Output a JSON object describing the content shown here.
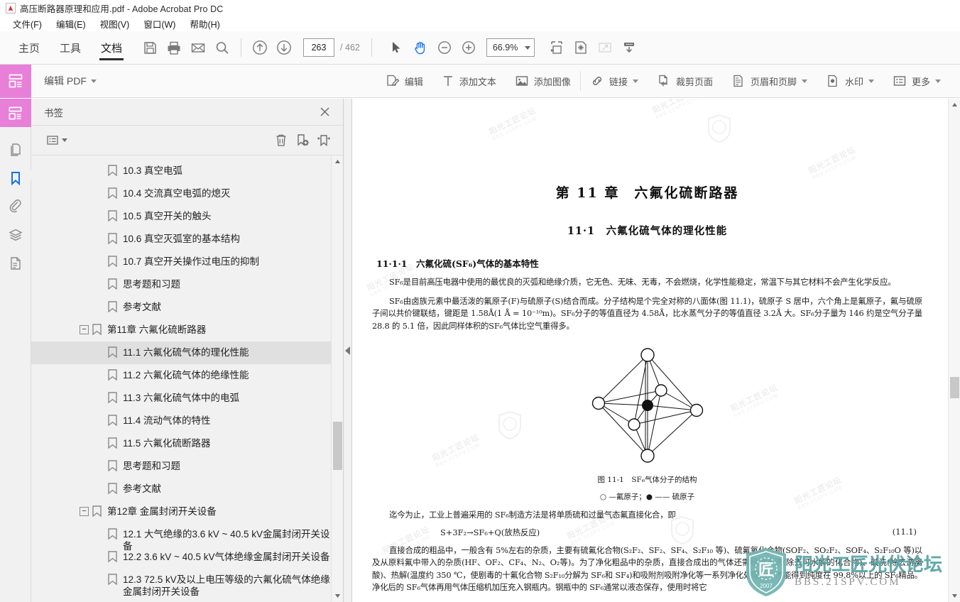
{
  "window": {
    "title": "高压断路器原理和应用.pdf - Adobe Acrobat Pro DC",
    "app_icon": "acrobat-logo-icon"
  },
  "menubar": {
    "items": [
      {
        "label": "文件(F)",
        "name": "menu-file"
      },
      {
        "label": "编辑(E)",
        "name": "menu-edit"
      },
      {
        "label": "视图(V)",
        "name": "menu-view"
      },
      {
        "label": "窗口(W)",
        "name": "menu-window"
      },
      {
        "label": "帮助(H)",
        "name": "menu-help"
      }
    ]
  },
  "toolbar": {
    "tabs": [
      {
        "label": "主页",
        "active": false
      },
      {
        "label": "工具",
        "active": false
      },
      {
        "label": "文档",
        "active": true
      }
    ],
    "buttons": [
      {
        "name": "save-button",
        "icon": "floppy-disk-icon"
      },
      {
        "name": "print-button",
        "icon": "printer-icon"
      },
      {
        "name": "email-button",
        "icon": "envelope-icon"
      },
      {
        "name": "search-button",
        "icon": "search-icon"
      }
    ],
    "prev_page_icon": "arrow-up-circle-icon",
    "next_page_icon": "arrow-down-circle-icon",
    "page_number": "263",
    "page_total": "/ 462",
    "select_tool_icon": "cursor-arrow-icon",
    "hand_tool_icon": "hand-icon",
    "zoom_out_icon": "minus-circle-icon",
    "zoom_in_icon": "plus-circle-icon",
    "zoom_value": "66.9%",
    "fit_width_icon": "fit-width-icon",
    "fit_page_icon": "fit-page-icon",
    "full_screen_icon": "full-screen-icon",
    "scroll_mode_icon": "scroll-mode-icon"
  },
  "subtoolbar": {
    "panel_icon": "edit-pdf-panel-icon",
    "title": "编辑 PDF",
    "title_caret": "▾",
    "tools": [
      {
        "label": "编辑",
        "icon": "edit-document-icon",
        "caret": false
      },
      {
        "label": "添加文本",
        "icon": "add-text-icon",
        "caret": false
      },
      {
        "label": "添加图像",
        "icon": "add-image-icon",
        "caret": false
      },
      {
        "label": "链接",
        "icon": "link-icon",
        "caret": true
      },
      {
        "label": "裁剪页面",
        "icon": "crop-page-icon",
        "caret": false
      },
      {
        "label": "页眉和页脚",
        "icon": "header-footer-icon",
        "caret": true
      },
      {
        "label": "水印",
        "icon": "watermark-icon",
        "caret": true
      },
      {
        "label": "更多",
        "icon": "more-list-icon",
        "caret": true
      }
    ]
  },
  "rail": {
    "items": [
      {
        "name": "rail-edit-pdf",
        "icon": "edit-pdf-panel-icon",
        "active": true,
        "highlight": true
      },
      {
        "name": "rail-page-thumbnails",
        "icon": "page-thumbnails-icon",
        "active": false
      },
      {
        "name": "rail-bookmarks",
        "icon": "bookmark-icon",
        "active": true
      },
      {
        "name": "rail-attachments",
        "icon": "paperclip-icon",
        "active": false
      },
      {
        "name": "rail-layers",
        "icon": "layers-icon",
        "active": false
      },
      {
        "name": "rail-content",
        "icon": "document-content-icon",
        "active": false
      }
    ]
  },
  "bookmarks_panel": {
    "title": "书签",
    "close_icon": "close-icon",
    "options_icon": "options-list-icon",
    "options_caret": "▾",
    "delete_icon": "trash-icon",
    "new_bookmark_icon": "new-bookmark-icon",
    "expand_icon": "expand-bookmarks-icon",
    "items": [
      {
        "label": "10.3 真空电弧",
        "level": 2,
        "expander": null,
        "selected": false
      },
      {
        "label": "10.4 交流真空电弧的熄灭",
        "level": 2,
        "expander": null,
        "selected": false
      },
      {
        "label": "10.5 真空开关的触头",
        "level": 2,
        "expander": null,
        "selected": false
      },
      {
        "label": "10.6 真空灭弧室的基本结构",
        "level": 2,
        "expander": null,
        "selected": false
      },
      {
        "label": "10.7 真空开关操作过电压的抑制",
        "level": 2,
        "expander": null,
        "selected": false
      },
      {
        "label": "思考题和习题",
        "level": 2,
        "expander": null,
        "selected": false
      },
      {
        "label": "参考文献",
        "level": 2,
        "expander": null,
        "selected": false
      },
      {
        "label": "第11章 六氟化硫断路器",
        "level": 1,
        "expander": "−",
        "selected": false
      },
      {
        "label": "11.1 六氟化硫气体的理化性能",
        "level": 2,
        "expander": null,
        "selected": true
      },
      {
        "label": "11.2 六氟化硫气体的绝缘性能",
        "level": 2,
        "expander": null,
        "selected": false
      },
      {
        "label": "11.3 六氟化硫气体中的电弧",
        "level": 2,
        "expander": null,
        "selected": false
      },
      {
        "label": "11.4 流动气体的特性",
        "level": 2,
        "expander": null,
        "selected": false
      },
      {
        "label": "11.5 六氟化硫断路器",
        "level": 2,
        "expander": null,
        "selected": false
      },
      {
        "label": "思考题和习题",
        "level": 2,
        "expander": null,
        "selected": false
      },
      {
        "label": "参考文献",
        "level": 2,
        "expander": null,
        "selected": false
      },
      {
        "label": "第12章 金属封闭开关设备",
        "level": 1,
        "expander": "−",
        "selected": false
      },
      {
        "label": "12.1 大气绝缘的3.6 kV ~ 40.5 kV金属封闭开关设备",
        "level": 2,
        "expander": null,
        "selected": false
      },
      {
        "label": "12.2 3.6 kV ~ 40.5 kV气体绝缘金属封闭开关设备",
        "level": 2,
        "expander": null,
        "selected": false
      },
      {
        "label": "12.3 72.5 kV及以上电压等级的六氟化硫气体绝缘金属封闭开关设备",
        "level": 2,
        "expander": null,
        "selected": false,
        "twoline": true
      }
    ]
  },
  "document": {
    "chapter_title": "第 11 章　六氟化硫断路器",
    "section_title": "11·1　六氟化硫气体的理化性能",
    "subsection_title": "11·1·1　六氟化硫(SF₆)气体的基本特性",
    "paragraphs": [
      "SF₆是目前高压电器中使用的最优良的灭弧和绝缘介质，它无色、无味、无毒，不会燃烧，化学性能稳定，常温下与其它材料不会产生化学反应。",
      "SF₆由卤族元素中最活泼的氟原子(F)与硫原子(S)结合而成。分子结构是个完全对称的八面体(图 11.1)，硫原子 S 居中，六个角上是氟原子，氟与硫原子间以共价键联结，键距是 1.58Å(1 Å = 10⁻¹⁰m)。SF₆分子的等值直径为 4.58Å，比水蒸气分子的等值直径 3.2Å 大。SF₆分子量为 146 约是空气分子量 28.8 的 5.1 倍，因此同样体积的SF₆气体比空气重得多。"
    ],
    "figure_caption": "图 11-1　SF₆气体分子的结构",
    "figure_legend": "○ —氟原子；● —— 硫原子",
    "after_figure_paragraph": "迄今为止，工业上普遍采用的 SF₆制造方法是将单质硫和过量气态氟直接化合，即",
    "equation": "S+3F₂→SF₆+Q(放热反应)",
    "equation_number": "(11.1)",
    "tail_paragraphs": [
      "直接合成的粗品中，一般含有 5%左右的杂质，主要有硫氟化合物(S₂F₂、SF₂、SF₄、S₂F₁₀ 等)、硫氟氧化合物(SOF₂、SO₂F₂、SOF₄、S₂F₁₀O 等)以及从原料氟中带入的杂质(HF、OF₂、CF₄、N₂、O₂等)。为了净化粗品中的杂质，直接合成出的气体还需经过水洗(除去可水解的化合物)、碱洗(除去游离酸)、热解(温度约 350 ℃，使剧毒的十氟化合物 S₂F₁₀分解为 SF₆和 SF₄)和吸附剂吸附净化等一系列净化处理后，才能得到纯度在 99.8%以上的 SF₆精品。净化后的 SF₆气体再用气体压缩机加压充入钢瓶内。钢瓶中的 SF₆通常以液态保存，使用时将它"
    ],
    "watermark_text": "阳光工匠论坛",
    "watermark_sub": "BBS.21SPV.COM"
  },
  "corner_logo": {
    "shield_year": "2007",
    "shield_glyph": "匠",
    "main_text": "阳光工匠光伏论坛",
    "sub_text": "BBS.21SPV.COM"
  },
  "colors": {
    "accent_pink": "#e87fd8",
    "bookmark_blue": "#1473e6",
    "logo_teal": "#57a3a3",
    "selection_gray": "#e0e0e0"
  }
}
